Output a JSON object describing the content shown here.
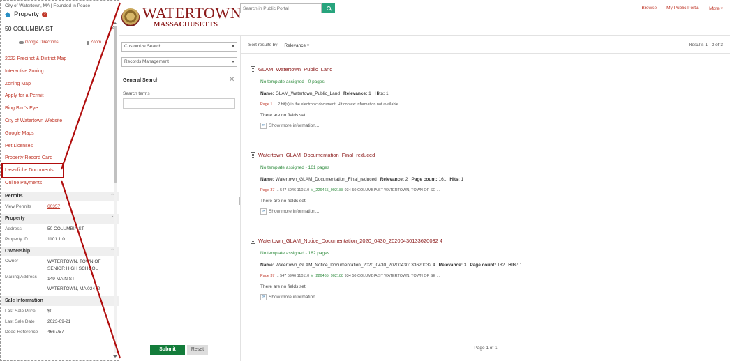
{
  "left_panel": {
    "city_line": "City of Watertown, MA | Founded in Peace",
    "property_title": "Property",
    "address": "50 COLUMBIA ST",
    "directions_label": "Google Directions",
    "zoom_label": "Zoom",
    "links": [
      {
        "label": "2022 Precinct & District Map"
      },
      {
        "label": "Interactive Zoning"
      },
      {
        "label": "Zoning Map"
      },
      {
        "label": "Apply for a Permit"
      },
      {
        "label": "Bing Bird's Eye"
      },
      {
        "label": "City of Watertown Website"
      },
      {
        "label": "Google Maps"
      },
      {
        "label": "Pet Licenses"
      },
      {
        "label": "Property Record Card"
      },
      {
        "label": "Laserfiche Documents"
      },
      {
        "label": "Online Payments"
      }
    ],
    "permits": {
      "title": "Permits",
      "view_label": "View Permits",
      "view_value": "60357"
    },
    "property": {
      "title": "Property",
      "address_label": "Address",
      "address_value": "50 COLUMBIA ST",
      "id_label": "Property ID",
      "id_value": "1101 1 0"
    },
    "ownership": {
      "title": "Ownership",
      "owner_label": "Owner",
      "owner_line1": "WATERTOWN, TOWN OF",
      "owner_line2": "SENIOR HIGH SCHOOL",
      "mailing_label": "Mailing Address",
      "mailing_line1": "149 MAIN ST",
      "mailing_line2": "WATERTOWN, MA 02472"
    },
    "sale": {
      "title": "Sale Information",
      "price_label": "Last Sale Price",
      "price_value": "$0",
      "date_label": "Last Sale Date",
      "date_value": "2023-09-21",
      "deed_label": "Deed Reference",
      "deed_value": "4667/57"
    }
  },
  "header": {
    "logo_line1": "WATERTOWN",
    "logo_line2": "MASSACHUSETTS",
    "search_placeholder": "Search in Public Portal",
    "nav": {
      "browse": "Browse",
      "my_portal": "My Public Portal",
      "more": "More ▾"
    }
  },
  "search_panel": {
    "customize": "Customize Search",
    "records": "Records Management",
    "title": "General Search",
    "terms_label": "Search terms",
    "submit": "Submit",
    "reset": "Reset"
  },
  "results": {
    "sort_label": "Sort results by:",
    "sort_value": "Relevance ▾",
    "count": "Results  1 - 3 of 3",
    "pager": "Page 1 of 1",
    "no_fields": "There are no fields set.",
    "show_more": "Show more information...",
    "items": [
      {
        "title": "GLAM_Watertown_Public_Land",
        "template": "No template assigned - 0 pages",
        "name": "GLAM_Watertown_Public_Land",
        "relevance": "1",
        "page_count": "",
        "hits": "1",
        "ctx_page": "Page 1",
        "ctx_pre": " ... 2 hit(s) in the electronic document. Hit context information not available. ...",
        "ctx_hit": "",
        "ctx_post": ""
      },
      {
        "title": "Watertown_GLAM_Documentation_Final_reduced",
        "template": "No template assigned - 161 pages",
        "name": "Watertown_GLAM_Documentation_Final_reduced",
        "relevance": "2",
        "page_count": "161",
        "hits": "1",
        "ctx_page": "Page 37",
        "ctx_pre": " ... 547 5946 110110 ",
        "ctx_hit": "M_226465_902188",
        "ctx_post": " 934 50 COLUMBIA ST WATERTOWN, TOWN OF SE ..."
      },
      {
        "title": "Watertown_GLAM_Notice_Documentation_2020_0430_20200430133620032 4",
        "template": "No template assigned - 182 pages",
        "name": "Watertown_GLAM_Notice_Documentation_2020_0430_20200430133620032 4",
        "relevance": "3",
        "page_count": "182",
        "hits": "1",
        "ctx_page": "Page 37",
        "ctx_pre": " ... 547 5946 110110 ",
        "ctx_hit": "M_226465_902188",
        "ctx_post": " 934 50 COLUMBIA ST WATERTOWN, TOWN OF SE ..."
      }
    ]
  },
  "labels": {
    "name": "Name:",
    "relevance": "Relevance:",
    "page_count": "Page count:",
    "hits": "Hits:"
  },
  "colors": {
    "accent_red": "#c0392b",
    "brand_dark_red": "#8b1a1a",
    "submit_green": "#137c3a",
    "search_green": "#27a47d",
    "template_green": "#2e8b3d",
    "annotation_red": "#b10d0d"
  }
}
